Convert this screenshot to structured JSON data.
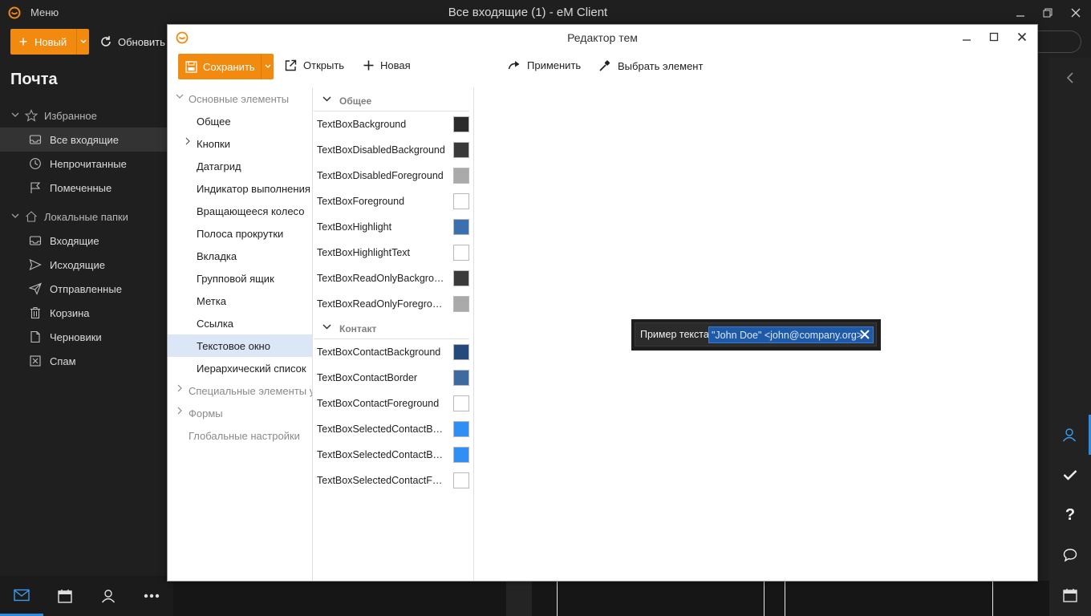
{
  "app": {
    "menu_label": "Меню",
    "window_title": "Все входящие (1) - eM Client",
    "new_button": "Новый",
    "refresh_button": "Обновить"
  },
  "sidebar": {
    "title": "Почта",
    "favorites_label": "Избранное",
    "local_label": "Локальные папки",
    "items": [
      {
        "label": "Все входящие",
        "icon": "inbox-icon"
      },
      {
        "label": "Непрочитанные",
        "icon": "clock-icon"
      },
      {
        "label": "Помеченные",
        "icon": "flag-icon"
      },
      {
        "label": "Входящие",
        "icon": "inbox-icon"
      },
      {
        "label": "Исходящие",
        "icon": "send-icon"
      },
      {
        "label": "Отправленные",
        "icon": "sent-icon"
      },
      {
        "label": "Корзина",
        "icon": "trash-icon"
      },
      {
        "label": "Черновики",
        "icon": "draft-icon"
      },
      {
        "label": "Спам",
        "icon": "spam-icon"
      }
    ]
  },
  "dialog": {
    "title": "Редактор тем",
    "toolbar": {
      "save": "Сохранить",
      "open": "Открыть",
      "new": "Новая",
      "apply": "Применить",
      "pick": "Выбрать элемент"
    },
    "tree": {
      "root_basic": "Основные элементы",
      "items": [
        "Общее",
        "Кнопки",
        "Датагрид",
        "Индикатор выполнения",
        "Вращающееся колесо",
        "Полоса прокрутки",
        "Вкладка",
        "Групповой ящик",
        "Метка",
        "Ссылка",
        "Текстовое окно",
        "Иерархический список"
      ],
      "root_special": "Специальные элементы управления",
      "root_forms": "Формы",
      "root_global": "Глобальные настройки"
    },
    "sections": {
      "general": "Общее",
      "contact": "Контакт"
    },
    "props_general": [
      {
        "name": "TextBoxBackground",
        "color": "#2b2b2b"
      },
      {
        "name": "TextBoxDisabledBackground",
        "color": "#3a3a3a"
      },
      {
        "name": "TextBoxDisabledForeground",
        "color": "#aaaaaa"
      },
      {
        "name": "TextBoxForeground",
        "color": "#ffffff"
      },
      {
        "name": "TextBoxHighlight",
        "color": "#3b6fae"
      },
      {
        "name": "TextBoxHighlightText",
        "color": "#ffffff"
      },
      {
        "name": "TextBoxReadOnlyBackground",
        "color": "#3a3a3a"
      },
      {
        "name": "TextBoxReadOnlyForeground",
        "color": "#aaaaaa"
      }
    ],
    "props_contact": [
      {
        "name": "TextBoxContactBackground",
        "color": "#234a7a"
      },
      {
        "name": "TextBoxContactBorder",
        "color": "#3e6a9e"
      },
      {
        "name": "TextBoxContactForeground",
        "color": "#ffffff"
      },
      {
        "name": "TextBoxSelectedContactBackground",
        "color": "#2f8ff5"
      },
      {
        "name": "TextBoxSelectedContactBorder",
        "color": "#2f8ff5"
      },
      {
        "name": "TextBoxSelectedContactForeground",
        "color": "#ffffff"
      }
    ],
    "preview": {
      "label": "Пример текста",
      "contact": "\"John Doe\" <john@company.org>"
    }
  }
}
